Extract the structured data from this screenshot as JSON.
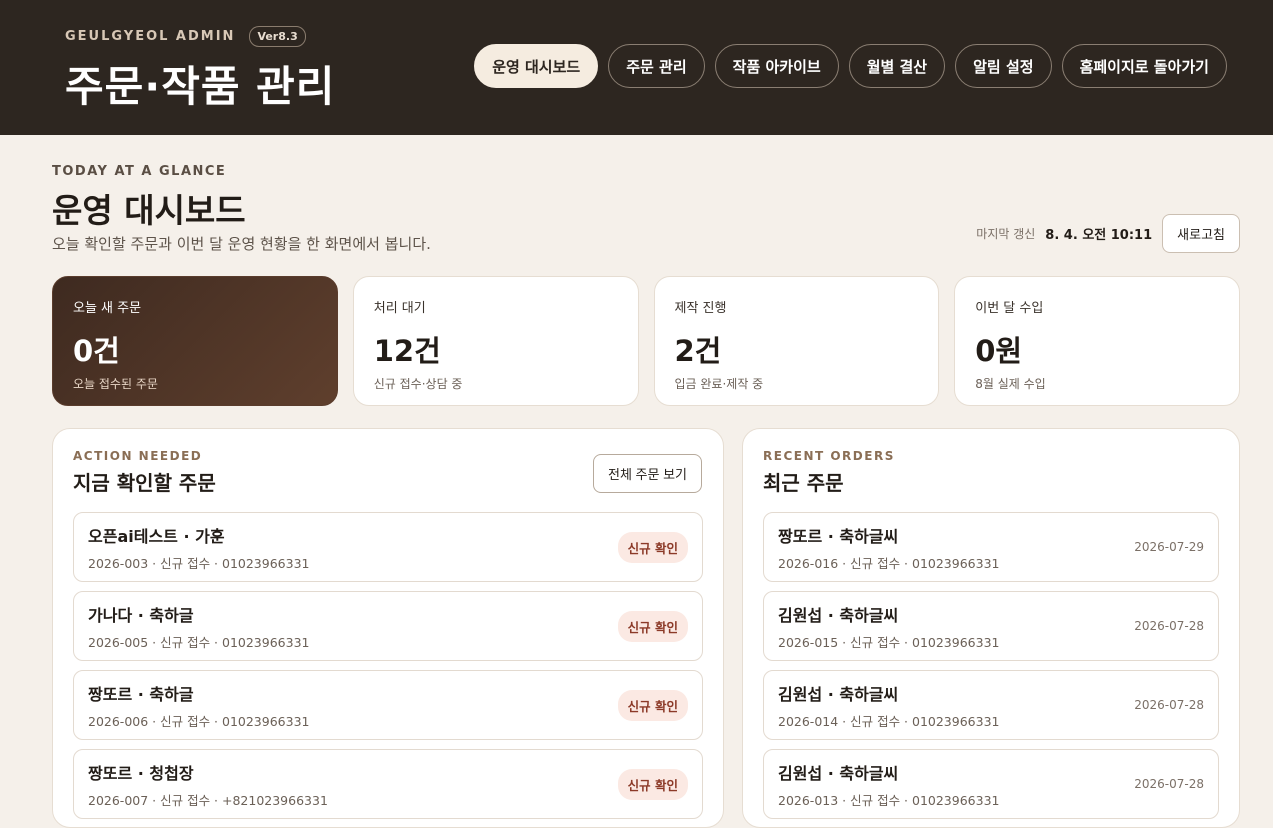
{
  "header": {
    "brand": "GEULGYEOL ADMIN",
    "version": "Ver8.3",
    "title": "주문·작품 관리",
    "nav": [
      {
        "label": "운영 대시보드",
        "active": true
      },
      {
        "label": "주문 관리",
        "active": false
      },
      {
        "label": "작품 아카이브",
        "active": false
      },
      {
        "label": "월별 결산",
        "active": false
      },
      {
        "label": "알림 설정",
        "active": false
      },
      {
        "label": "홈페이지로 돌아가기",
        "active": false
      }
    ]
  },
  "page": {
    "eyebrow": "TODAY AT A GLANCE",
    "title": "운영 대시보드",
    "description": "오늘 확인할 주문과 이번 달 운영 현황을 한 화면에서 봅니다.",
    "updated_label": "마지막 갱신",
    "updated_value": "8. 4. 오전 10:11",
    "refresh_label": "새로고침"
  },
  "stats": [
    {
      "label": "오늘 새 주문",
      "value": "0건",
      "sub": "오늘 접수된 주문"
    },
    {
      "label": "처리 대기",
      "value": "12건",
      "sub": "신규 접수·상담 중"
    },
    {
      "label": "제작 진행",
      "value": "2건",
      "sub": "입금 완료·제작 중"
    },
    {
      "label": "이번 달 수입",
      "value": "0원",
      "sub": "8월 실제 수입"
    }
  ],
  "action_needed": {
    "eyebrow": "ACTION NEEDED",
    "title": "지금 확인할 주문",
    "view_all_label": "전체 주문 보기",
    "items": [
      {
        "name": "오픈ai테스트 · 가훈",
        "meta": "2026-003 · 신규 접수 · 01023966331",
        "badge": "신규 확인"
      },
      {
        "name": "가나다 · 축하글",
        "meta": "2026-005 · 신규 접수 · 01023966331",
        "badge": "신규 확인"
      },
      {
        "name": "짱또르 · 축하글",
        "meta": "2026-006 · 신규 접수 · 01023966331",
        "badge": "신규 확인"
      },
      {
        "name": "짱또르 · 청첩장",
        "meta": "2026-007 · 신규 접수 · +821023966331",
        "badge": "신규 확인"
      }
    ]
  },
  "recent_orders": {
    "eyebrow": "RECENT ORDERS",
    "title": "최근 주문",
    "items": [
      {
        "name": "짱또르 · 축하글씨",
        "meta": "2026-016 · 신규 접수 · 01023966331",
        "date": "2026-07-29"
      },
      {
        "name": "김원섭 · 축하글씨",
        "meta": "2026-015 · 신규 접수 · 01023966331",
        "date": "2026-07-28"
      },
      {
        "name": "김원섭 · 축하글씨",
        "meta": "2026-014 · 신규 접수 · 01023966331",
        "date": "2026-07-28"
      },
      {
        "name": "김원섭 · 축하글씨",
        "meta": "2026-013 · 신규 접수 · 01023966331",
        "date": "2026-07-28"
      }
    ]
  }
}
